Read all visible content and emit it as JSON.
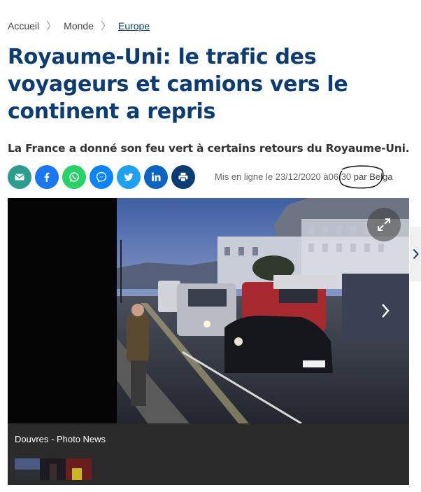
{
  "breadcrumb": {
    "items": [
      "Accueil",
      "Monde",
      "Europe"
    ]
  },
  "article": {
    "title": "Royaume-Uni: le trafic des voyageurs et camions vers le continent a repris",
    "subtitle": "La France a donné son feu vert à certains retours du Royaume-Uni.",
    "meta": {
      "prefix": "Mis en ligne le 23/12/2020 à",
      "time": "06:30",
      "author": "par Belga"
    }
  },
  "share": {
    "icons": [
      "mail-icon",
      "facebook-icon",
      "whatsapp-icon",
      "messenger-icon",
      "twitter-icon",
      "linkedin-icon",
      "print-icon"
    ]
  },
  "media": {
    "caption": "Douvres - Photo News"
  },
  "colors": {
    "brand_blue": "#0b3c74",
    "mail": "#2a9d8f",
    "facebook": "#1877f2",
    "whatsapp": "#25d366",
    "messenger": "#0a84ff",
    "twitter": "#1da1f2",
    "linkedin": "#0a66c2"
  }
}
